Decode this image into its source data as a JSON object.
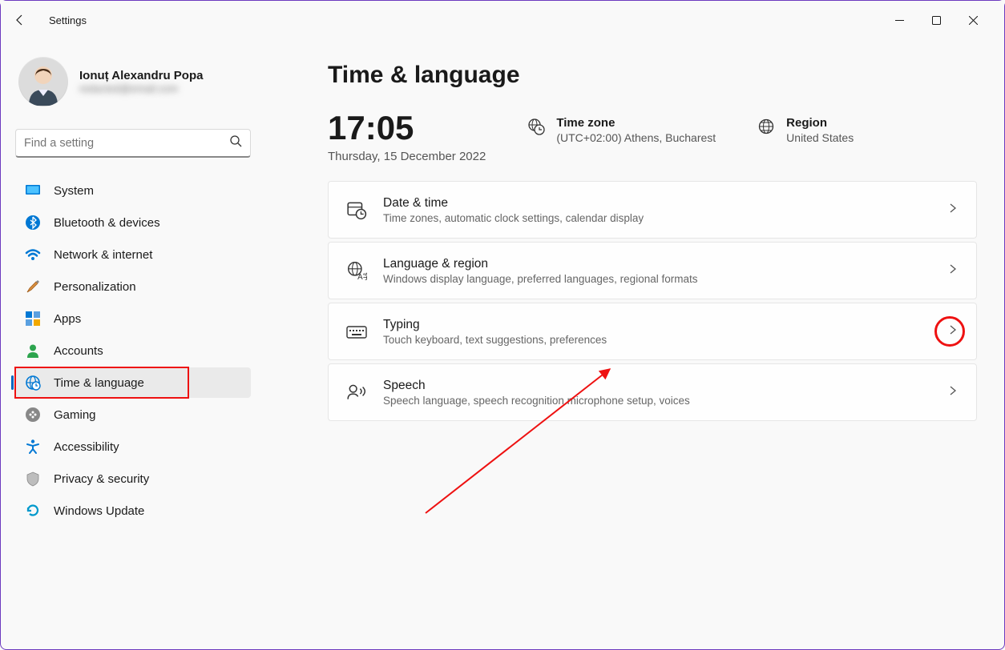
{
  "app": {
    "title": "Settings"
  },
  "profile": {
    "name": "Ionuț Alexandru Popa",
    "email": "redacted@email.com"
  },
  "search": {
    "placeholder": "Find a setting"
  },
  "sidebar": {
    "items": [
      {
        "label": "System",
        "icon": "system"
      },
      {
        "label": "Bluetooth & devices",
        "icon": "bluetooth"
      },
      {
        "label": "Network & internet",
        "icon": "wifi"
      },
      {
        "label": "Personalization",
        "icon": "brush"
      },
      {
        "label": "Apps",
        "icon": "apps"
      },
      {
        "label": "Accounts",
        "icon": "person"
      },
      {
        "label": "Time & language",
        "icon": "clock-globe",
        "selected": true
      },
      {
        "label": "Gaming",
        "icon": "gaming"
      },
      {
        "label": "Accessibility",
        "icon": "accessibility"
      },
      {
        "label": "Privacy & security",
        "icon": "shield"
      },
      {
        "label": "Windows Update",
        "icon": "update"
      }
    ]
  },
  "page": {
    "title": "Time & language",
    "clock": {
      "time": "17:05",
      "date": "Thursday, 15 December 2022"
    },
    "timezone": {
      "label": "Time zone",
      "value": "(UTC+02:00) Athens, Bucharest"
    },
    "region": {
      "label": "Region",
      "value": "United States"
    },
    "cards": [
      {
        "title": "Date & time",
        "sub": "Time zones, automatic clock settings, calendar display",
        "icon": "datetime"
      },
      {
        "title": "Language & region",
        "sub": "Windows display language, preferred languages, regional formats",
        "icon": "lang"
      },
      {
        "title": "Typing",
        "sub": "Touch keyboard, text suggestions, preferences",
        "icon": "keyboard",
        "annotated": true
      },
      {
        "title": "Speech",
        "sub": "Speech language, speech recognition microphone setup, voices",
        "icon": "speech"
      }
    ]
  }
}
